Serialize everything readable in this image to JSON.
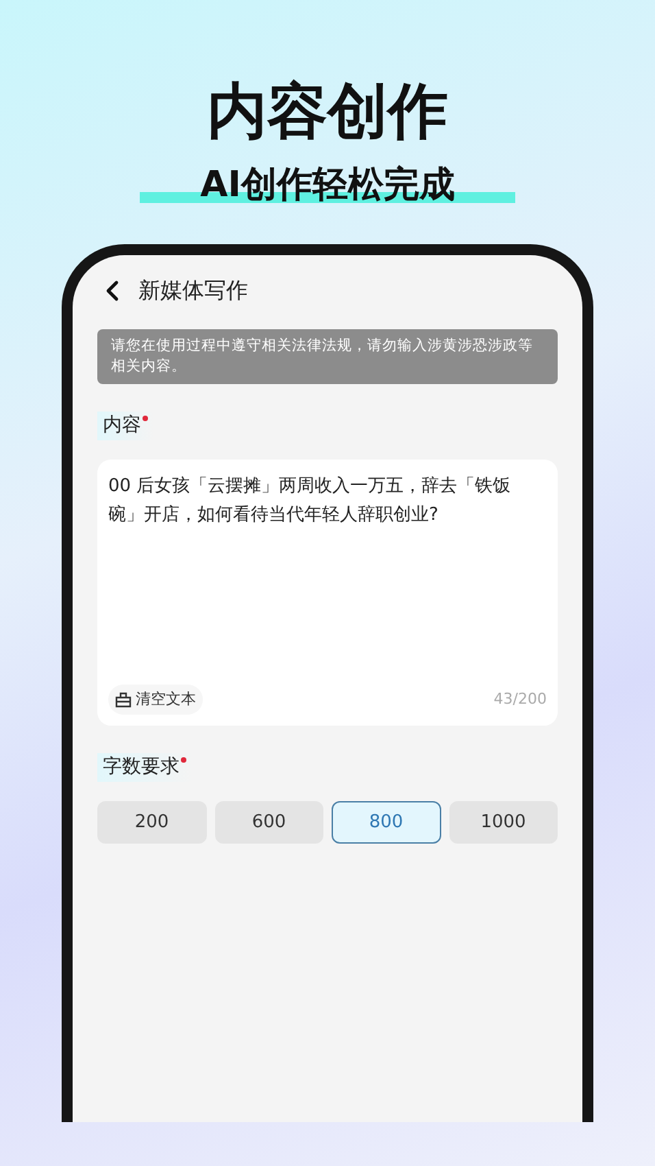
{
  "headline": "内容创作",
  "subtitle": "AI创作轻松完成",
  "header": {
    "title": "新媒体写作"
  },
  "notice": "请您在使用过程中遵守相关法律法规，请勿输入涉黄涉恐涉政等相关内容。",
  "content": {
    "label": "内容",
    "required": true,
    "value": "00 后女孩「云摆摊」两周收入一万五，辞去「铁饭碗」开店，如何看待当代年轻人辞职创业?",
    "clear_button": "清空文本",
    "counter": "43/200"
  },
  "word_count": {
    "label": "字数要求",
    "required": true,
    "options": [
      {
        "label": "200",
        "selected": false
      },
      {
        "label": "600",
        "selected": false
      },
      {
        "label": "800",
        "selected": true
      },
      {
        "label": "1000",
        "selected": false
      }
    ]
  }
}
